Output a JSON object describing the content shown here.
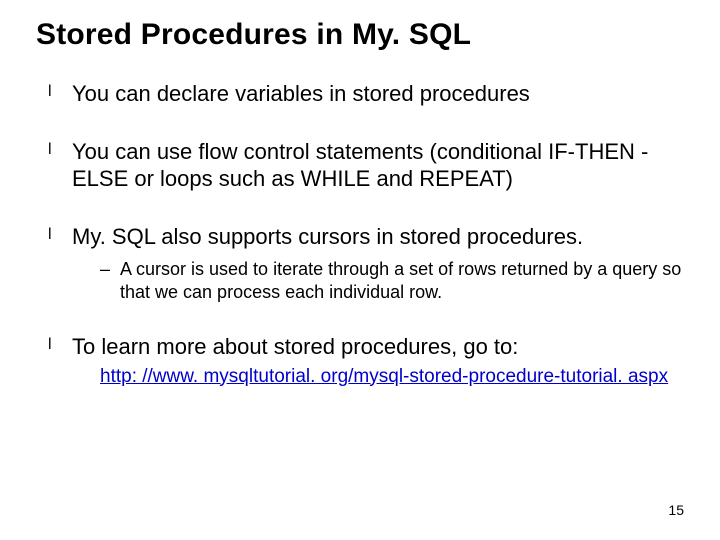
{
  "title": "Stored Procedures in My. SQL",
  "bullets": {
    "b1": "You can declare variables in stored procedures",
    "b2": "You can use flow control statements (conditional IF-THEN -ELSE or loops such as WHILE and REPEAT)",
    "b3": "My. SQL also supports cursors in stored procedures.",
    "b3sub": "A cursor is used to iterate through a set of rows returned by a query so that we can process each individual row.",
    "b4": "To learn more about stored procedures, go to:",
    "b4link": "http: //www. mysqltutorial. org/mysql-stored-procedure-tutorial. aspx"
  },
  "page_number": "15"
}
